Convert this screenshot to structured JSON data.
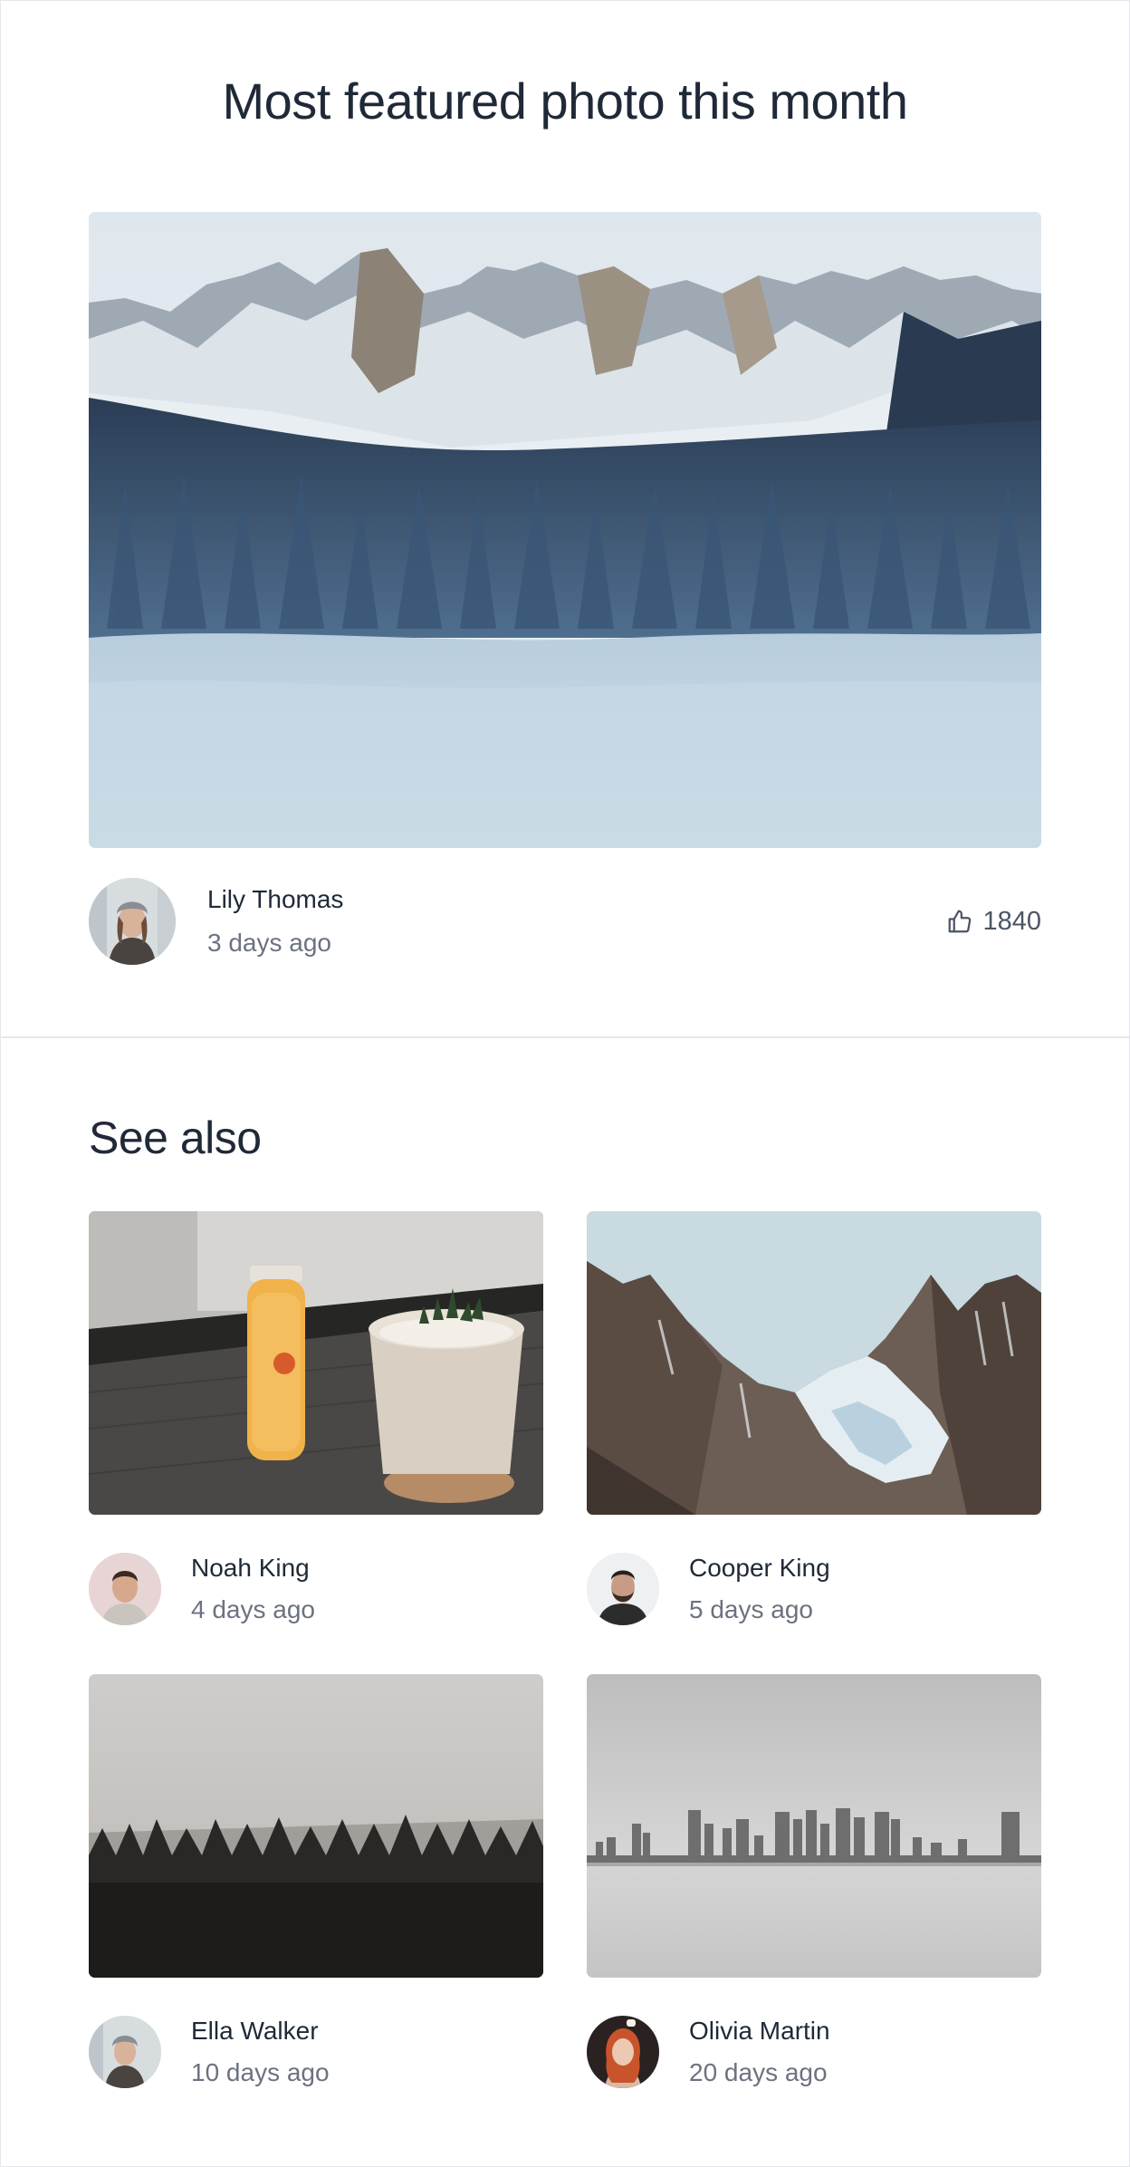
{
  "featured": {
    "title": "Most featured photo this month",
    "photo_icon": "snowy-mountain-forest-lake-photo",
    "author": {
      "name": "Lily Thomas",
      "time": "3 days ago"
    },
    "likes": "1840",
    "like_icon": "thumbs-up-icon"
  },
  "see_also": {
    "title": "See also",
    "cards": [
      {
        "photo_icon": "juice-bottle-and-plant-photo",
        "author": {
          "name": "Noah King",
          "time": "4 days ago"
        }
      },
      {
        "photo_icon": "rocky-mountain-peaks-photo",
        "author": {
          "name": "Cooper King",
          "time": "5 days ago"
        }
      },
      {
        "photo_icon": "foggy-forest-photo",
        "author": {
          "name": "Ella Walker",
          "time": "10 days ago"
        }
      },
      {
        "photo_icon": "city-skyline-waterfront-photo",
        "author": {
          "name": "Olivia Martin",
          "time": "20 days ago"
        }
      }
    ]
  },
  "colors": {
    "heading": "#1f2937",
    "muted_text": "#6b7280",
    "divider": "#e5e7eb"
  }
}
